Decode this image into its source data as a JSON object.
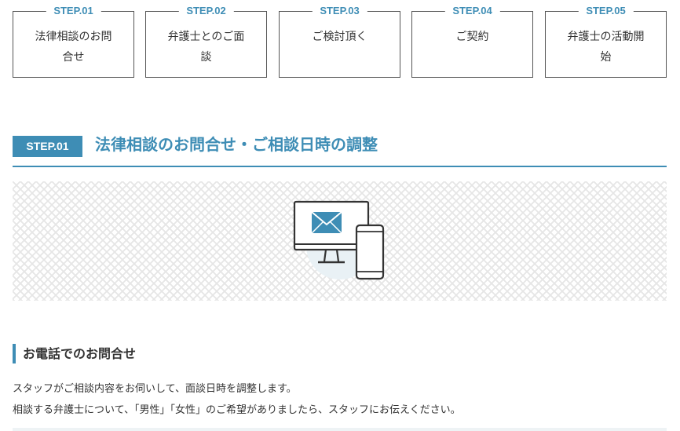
{
  "steps": [
    {
      "label": "STEP.01",
      "text_line1": "法律相談のお問",
      "text_line2": "合せ"
    },
    {
      "label": "STEP.02",
      "text_line1": "弁護士とのご面",
      "text_line2": "談"
    },
    {
      "label": "STEP.03",
      "text_line1": "ご検討頂く",
      "text_line2": ""
    },
    {
      "label": "STEP.04",
      "text_line1": "ご契約",
      "text_line2": ""
    },
    {
      "label": "STEP.05",
      "text_line1": "弁護士の活動開",
      "text_line2": "始"
    }
  ],
  "section": {
    "badge": "STEP.01",
    "title": "法律相談のお問合せ・ご相談日時の調整"
  },
  "illustration": {
    "icon": "computer-and-smartphone-mail-icon"
  },
  "contact": {
    "heading": "お電話でのお問合せ",
    "paragraph_line1": "スタッフがご相談内容をお伺いして、面談日時を調整します。",
    "paragraph_line2": "相談する弁護士について、「男性」「女性」のご希望がありましたら、スタッフにお伝えください。"
  },
  "colors": {
    "accent": "#3e8db5",
    "text": "#333333",
    "border": "#555555"
  }
}
